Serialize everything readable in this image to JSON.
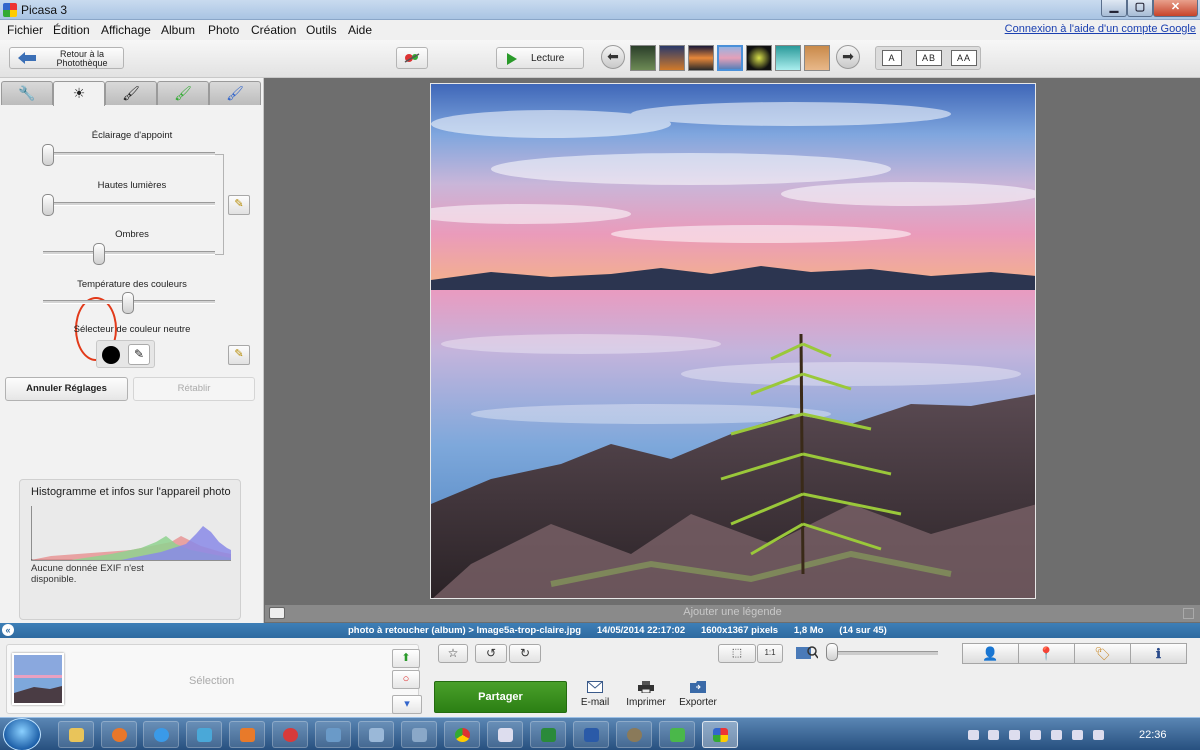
{
  "window": {
    "title": "Picasa 3",
    "minimize": "▁",
    "maximize": "▢",
    "close": "✕"
  },
  "menu": {
    "items": [
      "Fichier",
      "Édition",
      "Affichage",
      "Album",
      "Photo",
      "Création",
      "Outils",
      "Aide"
    ],
    "google_link": "Connexion à l'aide d'un compte Google"
  },
  "toolbar": {
    "back_label": "Retour à la Photothèque",
    "play_label": "Lecture",
    "prev_arrow": "⬅",
    "next_arrow": "➡",
    "caption_buttons": [
      "A",
      "AB",
      "AA"
    ]
  },
  "tabs": [
    {
      "icon": "wrench-icon",
      "glyph": "🔧"
    },
    {
      "icon": "sun-icon",
      "glyph": "☀"
    },
    {
      "icon": "brush-icon",
      "glyph": "🖌"
    },
    {
      "icon": "effects-brush-icon",
      "glyph": "🖌"
    },
    {
      "icon": "effects-brush-2-icon",
      "glyph": "🖌"
    }
  ],
  "tuning": {
    "fill_light_label": "Éclairage d'appoint",
    "highlights_label": "Hautes lumières",
    "shadows_label": "Ombres",
    "color_temp_label": "Température des couleurs",
    "neutral_picker_label": "Sélecteur de couleur neutre",
    "fill_light_value": 0.0,
    "highlights_value": 0.0,
    "shadows_value": 0.32,
    "color_temp_value": 0.5,
    "wand_glyph": "✎",
    "picker_glyph": "✎",
    "undo_label": "Annuler Réglages",
    "redo_label": "Rétablir"
  },
  "histogram": {
    "title": "Histogramme et infos sur l'appareil photo",
    "exif_text": "Aucune donnée EXIF n'est disponible."
  },
  "caption": {
    "placeholder": "Ajouter une légende"
  },
  "status": {
    "collapse": "«",
    "text": "photo à retoucher (album) > Image5a-trop-claire.jpg      14/05/2014 22:17:02      1600x1367 pixels      1,8 Mo      (14 sur 45)"
  },
  "tray": {
    "selection_label": "Sélection",
    "share_label": "Partager",
    "email_label": "E-mail",
    "print_label": "Imprimer",
    "export_label": "Exporter",
    "star": "☆",
    "rotate_left": "↺",
    "rotate_right": "↻",
    "zoom_fit": "⬚",
    "zoom_1to1": "1:1",
    "hold_glyph": "⬆",
    "remove_glyph": "○",
    "folder_glyph": "▾",
    "info_glyphs": [
      "👤",
      "📍",
      "🏷",
      "ℹ"
    ]
  },
  "taskbar": {
    "clock": "22:36"
  },
  "colors": {
    "status_blue": "#2f6aa0",
    "share_green": "#2c7f14",
    "highlight_red": "#e23a1a"
  }
}
